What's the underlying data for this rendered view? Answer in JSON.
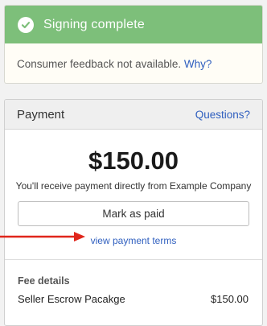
{
  "signing": {
    "title": "Signing complete",
    "feedback_text": "Consumer feedback not available.",
    "why_link": "Why?"
  },
  "payment": {
    "title": "Payment",
    "questions_link": "Questions?",
    "amount": "$150.00",
    "receive_text": "You'll receive payment directly from Example Company",
    "mark_paid_button": "Mark as paid",
    "terms_link": "view payment terms"
  },
  "fees": {
    "heading": "Fee details",
    "items": [
      {
        "name": "Seller Escrow Pacakge",
        "amount": "$150.00"
      }
    ]
  },
  "colors": {
    "success_header": "#7dbf7a",
    "link": "#2f5fbf",
    "annotation_arrow": "#e0261b"
  },
  "icons": {
    "success": "check-circle-icon",
    "annotation": "red-arrow-icon"
  }
}
